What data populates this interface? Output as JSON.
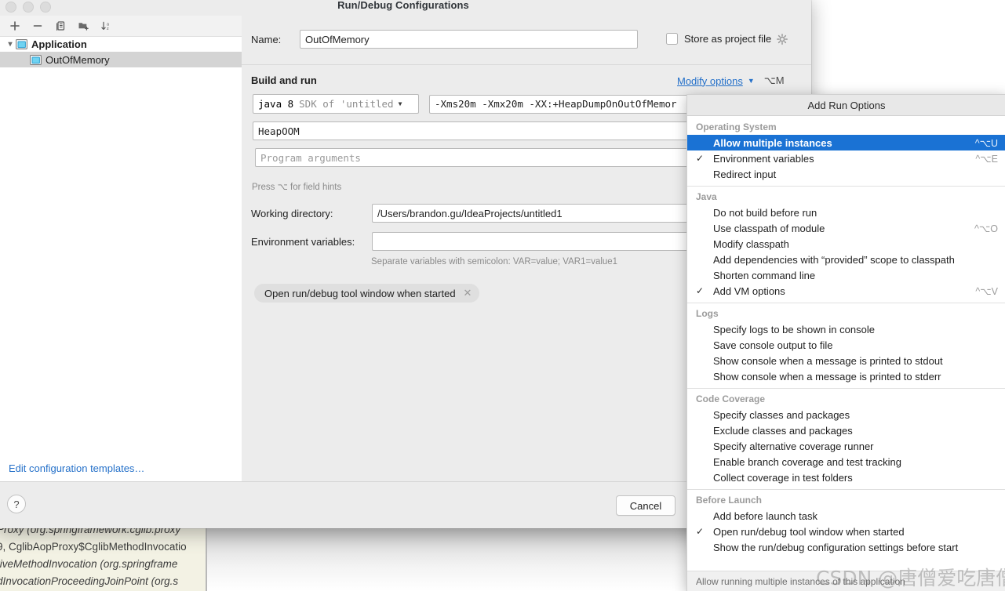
{
  "dialog": {
    "title": "Run/Debug Configurations",
    "name_label": "Name:",
    "name_value": "OutOfMemory",
    "store_as_project_file": "Store as project file",
    "gear_icon": "gear-icon",
    "build_and_run": "Build and run",
    "modify_options": "Modify options",
    "modify_options_shortcut": "⌥M",
    "sdk_value": "java 8",
    "sdk_hint": "SDK of 'untitled",
    "vm_options_value": "-Xms20m -Xmx20m -XX:+HeapDumpOnOutOfMemor",
    "main_class_value": "HeapOOM",
    "program_args_placeholder": "Program arguments",
    "field_hints": "Press ⌥ for field hints",
    "working_dir_label": "Working directory:",
    "working_dir_value": "/Users/brandon.gu/IdeaProjects/untitled1",
    "env_vars_label": "Environment variables:",
    "env_vars_value": "",
    "env_vars_hint": "Separate variables with semicolon: VAR=value; VAR1=value1",
    "chip_label": "Open run/debug tool window when started",
    "chip_close_icon": "close-icon",
    "edit_templates_link": "Edit configuration templates…",
    "help_label": "?",
    "cancel_label": "Cancel"
  },
  "sidebar": {
    "toolbar": [
      {
        "icon": "add-icon",
        "name": "add-configuration-button"
      },
      {
        "icon": "remove-icon",
        "name": "remove-configuration-button"
      },
      {
        "icon": "copy-icon",
        "name": "copy-configuration-button"
      },
      {
        "icon": "folder-add-icon",
        "name": "create-folder-button"
      },
      {
        "icon": "sort-alpha-icon",
        "name": "sort-configurations-button"
      }
    ],
    "tree": [
      {
        "label": "Application",
        "type": "root",
        "selected": false
      },
      {
        "label": "OutOfMemory",
        "type": "child",
        "selected": true
      }
    ]
  },
  "popup": {
    "title": "Add Run Options",
    "status": "Allow running multiple instances of this application",
    "groups": [
      {
        "header": "Operating System",
        "items": [
          {
            "label": "Allow multiple instances",
            "shortcut": "^⌥U",
            "checked": false,
            "highlighted": true
          },
          {
            "label": "Environment variables",
            "shortcut": "^⌥E",
            "checked": true,
            "highlighted": false
          },
          {
            "label": "Redirect input",
            "shortcut": "",
            "checked": false,
            "highlighted": false
          }
        ]
      },
      {
        "header": "Java",
        "items": [
          {
            "label": "Do not build before run",
            "shortcut": "",
            "checked": false,
            "highlighted": false
          },
          {
            "label": "Use classpath of module",
            "shortcut": "^⌥O",
            "checked": false,
            "highlighted": false
          },
          {
            "label": "Modify classpath",
            "shortcut": "",
            "checked": false,
            "highlighted": false
          },
          {
            "label": "Add dependencies with “provided” scope to classpath",
            "shortcut": "",
            "checked": false,
            "highlighted": false
          },
          {
            "label": "Shorten command line",
            "shortcut": "",
            "checked": false,
            "highlighted": false
          },
          {
            "label": "Add VM options",
            "shortcut": "^⌥V",
            "checked": true,
            "highlighted": false
          }
        ]
      },
      {
        "header": "Logs",
        "items": [
          {
            "label": "Specify logs to be shown in console",
            "shortcut": "",
            "checked": false,
            "highlighted": false
          },
          {
            "label": "Save console output to file",
            "shortcut": "",
            "checked": false,
            "highlighted": false
          },
          {
            "label": "Show console when a message is printed to stdout",
            "shortcut": "",
            "checked": false,
            "highlighted": false
          },
          {
            "label": "Show console when a message is printed to stderr",
            "shortcut": "",
            "checked": false,
            "highlighted": false
          }
        ]
      },
      {
        "header": "Code Coverage",
        "items": [
          {
            "label": "Specify classes and packages",
            "shortcut": "",
            "checked": false,
            "highlighted": false
          },
          {
            "label": "Exclude classes and packages",
            "shortcut": "",
            "checked": false,
            "highlighted": false
          },
          {
            "label": "Specify alternative coverage runner",
            "shortcut": "",
            "checked": false,
            "highlighted": false
          },
          {
            "label": "Enable branch coverage and test tracking",
            "shortcut": "",
            "checked": false,
            "highlighted": false
          },
          {
            "label": "Collect coverage in test folders",
            "shortcut": "",
            "checked": false,
            "highlighted": false
          }
        ]
      },
      {
        "header": "Before Launch",
        "items": [
          {
            "label": "Add before launch task",
            "shortcut": "",
            "checked": false,
            "highlighted": false
          },
          {
            "label": "Open run/debug tool window when started",
            "shortcut": "",
            "checked": true,
            "highlighted": false
          },
          {
            "label": "Show the run/debug configuration settings before start",
            "shortcut": "",
            "checked": false,
            "highlighted": false
          }
        ]
      }
    ]
  },
  "background_code": [
    "Proxy (org.springframework.cglib.proxy",
    "9, CglibAopProxy$CglibMethodInvocatio",
    "tiveMethodInvocation (org.springframe",
    "dInvocationProceedingJoinPoint (org.s"
  ],
  "watermark": "CSDN @唐僧爱吃唐僧肉",
  "colors": {
    "accent_blue": "#1a72d4",
    "link_blue": "#2470c9",
    "dialog_bg": "#ececec",
    "selection_gray": "#d4d4d4"
  }
}
